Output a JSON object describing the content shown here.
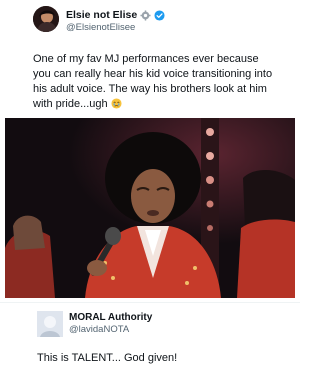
{
  "post": {
    "author_name": "Elsie not Elise",
    "author_handle": "@ElsienotElisee",
    "text": "One of my fav MJ performances ever because you can really hear his kid voice transitioning into his adult voice. The way his brothers look at him with pride...ugh",
    "trailing_emoji": "crying-face-emoji",
    "badge_icon": "verified-badge-icon",
    "name_emoji": "gear-emoji",
    "media": {
      "type": "video-still",
      "colors": {
        "background": "#120c10",
        "jacket": "#c63b2a",
        "stage_lights": "#e8a9a0"
      }
    }
  },
  "reply": {
    "author_name": "MORAL Authority",
    "author_handle": "@lavidaNOTA",
    "text": "This is TALENT... God given!"
  },
  "colors": {
    "verified": "#1d9bf0",
    "text_primary": "#0f1419",
    "text_secondary": "#536471"
  }
}
